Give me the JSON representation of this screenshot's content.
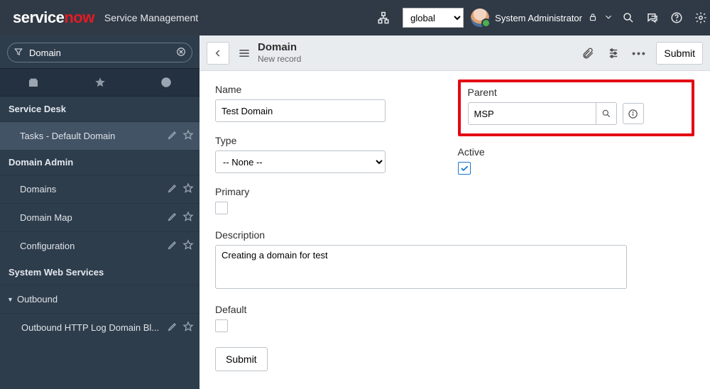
{
  "banner": {
    "logo1": "service",
    "logo2": "now",
    "app_title": "Service Management",
    "scope_value": "global",
    "user_name": "System Administrator"
  },
  "nav": {
    "filter_text": "Domain",
    "sections": {
      "service_desk": "Service Desk",
      "domain_admin": "Domain Admin",
      "web_services": "System Web Services"
    },
    "items": {
      "tasks": "Tasks - Default Domain",
      "domains": "Domains",
      "domain_map": "Domain Map",
      "configuration": "Configuration",
      "outbound": "Outbound",
      "outbound_log": "Outbound HTTP Log Domain Bl..."
    }
  },
  "form_header": {
    "title": "Domain",
    "subtitle": "New record",
    "submit": "Submit"
  },
  "form": {
    "name_label": "Name",
    "name_value": "Test Domain",
    "type_label": "Type",
    "type_value": "-- None --",
    "primary_label": "Primary",
    "description_label": "Description",
    "description_value": "Creating a domain for test",
    "default_label": "Default",
    "parent_label": "Parent",
    "parent_value": "MSP",
    "active_label": "Active",
    "submit": "Submit"
  }
}
